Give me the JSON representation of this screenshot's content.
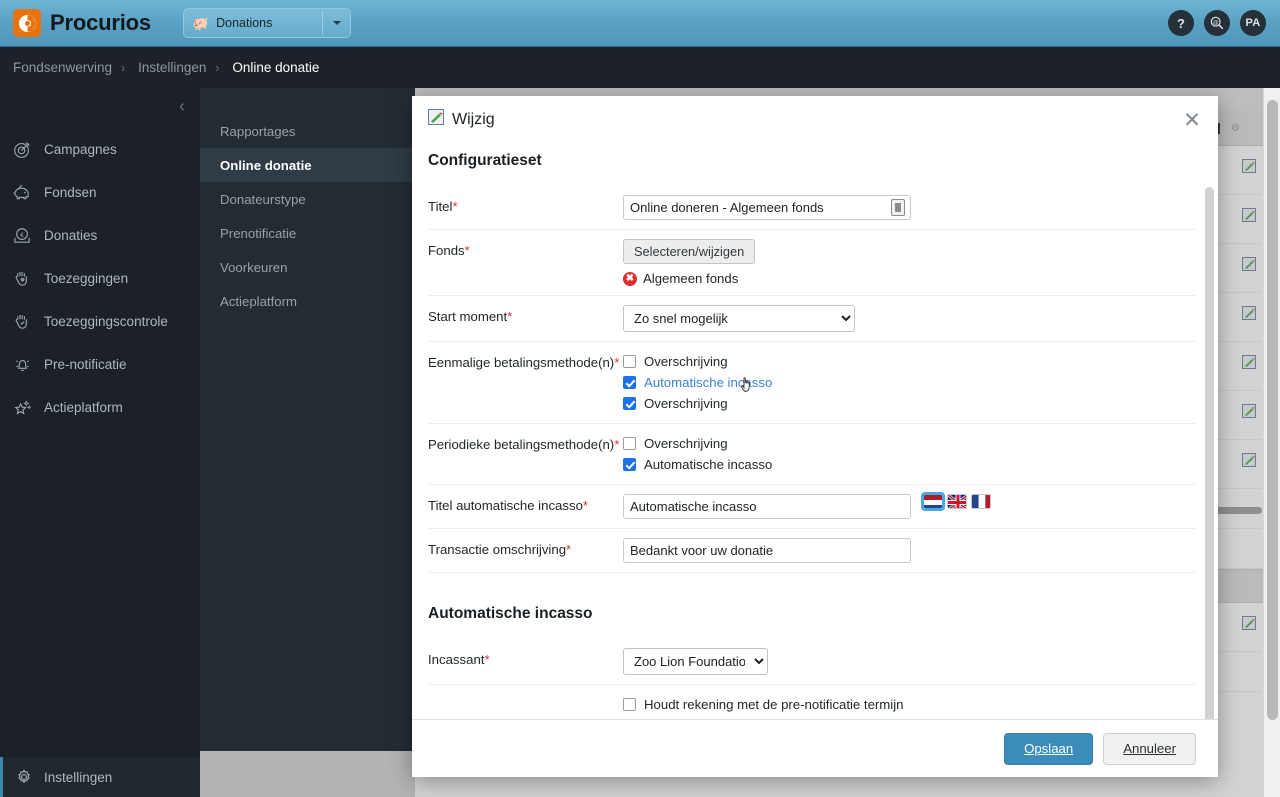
{
  "topbar": {
    "brand": "Procurios",
    "brand_color": "#e8720c",
    "app_switcher": {
      "label": "Donations",
      "icon": "pig-icon"
    },
    "icons": [
      {
        "name": "help-icon",
        "label": "?"
      },
      {
        "name": "search-icon",
        "label": ""
      },
      {
        "name": "avatar",
        "label": "PA"
      }
    ]
  },
  "breadcrumb": {
    "items": [
      "Fondsenwerving",
      "Instellingen",
      "Online donatie"
    ],
    "separator": "›"
  },
  "sidebar": {
    "collapse_label": "‹",
    "items": [
      {
        "label": "Campagnes",
        "icon": "target-icon"
      },
      {
        "label": "Fondsen",
        "icon": "piggy-bank-icon"
      },
      {
        "label": "Donaties",
        "icon": "euro-coin-icon"
      },
      {
        "label": "Toezeggingen",
        "icon": "hand-heart-icon"
      },
      {
        "label": "Toezeggingscontrole",
        "icon": "hand-check-icon"
      },
      {
        "label": "Pre-notificatie",
        "icon": "bell-icon"
      },
      {
        "label": "Actieplatform",
        "icon": "star-sparkle-icon"
      }
    ],
    "bottom": {
      "label": "Instellingen",
      "icon": "gear-icon",
      "accent": "#3c87ad"
    }
  },
  "subnav": {
    "items": [
      {
        "label": "Rapportages",
        "active": false
      },
      {
        "label": "Online donatie",
        "active": true
      },
      {
        "label": "Donateurstype",
        "active": false
      },
      {
        "label": "Prenotificatie",
        "active": false
      },
      {
        "label": "Voorkeuren",
        "active": false
      },
      {
        "label": "Actieplatform",
        "active": false
      }
    ]
  },
  "modal": {
    "title": "Wijzig",
    "title_icon": "edit-memo-icon",
    "close_label": "✕",
    "sections": [
      {
        "heading": "Configuratieset"
      },
      {
        "heading": "Automatische incasso"
      }
    ],
    "fields": {
      "titel": {
        "label": "Titel",
        "required": true,
        "value": "Online doneren - Algemeen fonds",
        "token_icon": "token-picker-icon"
      },
      "fonds": {
        "label": "Fonds",
        "required": true,
        "button": "Selecteren/wijzigen",
        "chip": "Algemeen fonds",
        "chip_remove_icon": "remove-circle-icon"
      },
      "start_moment": {
        "label": "Start moment",
        "required": true,
        "value": "Zo snel mogelijk",
        "options": [
          "Zo snel mogelijk"
        ]
      },
      "eenmalige": {
        "label": "Eenmalige betalingsmethode(n)",
        "required": true,
        "options": [
          {
            "label": "Overschrijving",
            "checked": false,
            "hover": false
          },
          {
            "label": "Automatische incasso",
            "checked": true,
            "hover": true
          },
          {
            "label": "Overschrijving",
            "checked": true,
            "hover": false
          }
        ]
      },
      "periodieke": {
        "label": "Periodieke betalingsmethode(n)",
        "required": true,
        "options": [
          {
            "label": "Overschrijving",
            "checked": false,
            "hover": false
          },
          {
            "label": "Automatische incasso",
            "checked": true,
            "hover": false
          }
        ]
      },
      "titel_incasso": {
        "label": "Titel automatische incasso",
        "required": true,
        "value": "Automatische incasso",
        "languages": [
          {
            "name": "flag-nl-icon",
            "selected": true
          },
          {
            "name": "flag-gb-icon",
            "selected": false
          },
          {
            "name": "flag-fr-icon",
            "selected": false
          }
        ]
      },
      "transactie": {
        "label": "Transactie omschrijving",
        "required": true,
        "value": "Bedankt voor uw donatie"
      },
      "incassant": {
        "label": "Incassant",
        "required": true,
        "value": "Zoo Lion Foundation",
        "options": [
          "Zoo Lion Foundation"
        ]
      },
      "prenotificatie": {
        "label": "Houdt rekening met de pre-notificatie termijn",
        "checked": false
      }
    },
    "footer": {
      "save": "Opslaan",
      "cancel": "Annuleer",
      "save_color": "#3b8cba"
    }
  }
}
